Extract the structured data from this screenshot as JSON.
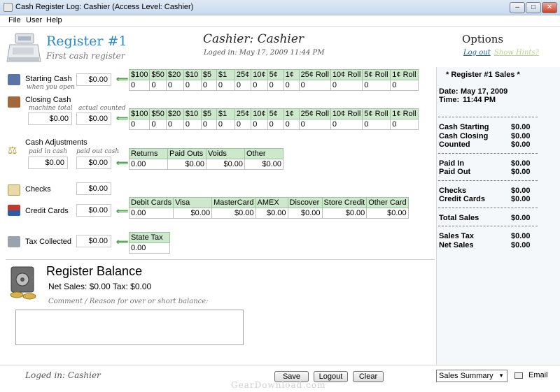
{
  "window": {
    "title": "Cash Register Log: Cashier (Access Level: Cashier)",
    "min": "–",
    "max": "□",
    "close": "✕"
  },
  "menu": [
    "File",
    "User",
    "Help"
  ],
  "header": {
    "register_title": "Register #1",
    "register_subtitle": "First cash register",
    "cashier_title": "Cashier: Cashier",
    "logged_time": "Loged in: May 17, 2009 11:44 PM",
    "options_title": "Options",
    "logout_link": "Log out",
    "hints_link": "Show Hints?"
  },
  "rows": {
    "starting": {
      "label": "Starting Cash",
      "sub": "when you open",
      "value": "$0.00"
    },
    "closing": {
      "label": "Closing Cash",
      "sub1": "machine total",
      "sub2": "actual counted",
      "value1": "$0.00",
      "value2": "$0.00"
    },
    "adjust": {
      "label": "Cash Adjustments",
      "sub1": "paid in cash",
      "sub2": "paid out cash",
      "value1": "$0.00",
      "value2": "$0.00"
    },
    "checks": {
      "label": "Checks",
      "value": "$0.00"
    },
    "credit": {
      "label": "Credit Cards",
      "value": "$0.00"
    },
    "tax": {
      "label": "Tax Collected",
      "value": "$0.00"
    }
  },
  "denominations": {
    "headers": [
      "$100",
      "$50",
      "$20",
      "$10",
      "$5",
      "$1",
      "25¢",
      "10¢",
      "5¢",
      "1¢",
      "25¢ Roll",
      "10¢ Roll",
      "5¢ Roll",
      "1¢ Roll"
    ],
    "starting_values": [
      "0",
      "0",
      "0",
      "0",
      "0",
      "0",
      "0",
      "0",
      "0",
      "0",
      "0",
      "0",
      "0",
      "0"
    ],
    "closing_values": [
      "0",
      "0",
      "0",
      "0",
      "0",
      "0",
      "0",
      "0",
      "0",
      "0",
      "0",
      "0",
      "0",
      "0"
    ]
  },
  "adjust_grid": {
    "headers": [
      "Returns",
      "Paid Outs",
      "Voids",
      "Other"
    ],
    "values": [
      "0.00",
      "$0.00",
      "$0.00",
      "$0.00"
    ]
  },
  "card_grid": {
    "headers": [
      "Debit Cards",
      "Visa",
      "MasterCard",
      "AMEX",
      "Discover",
      "Store Credit",
      "Other Card"
    ],
    "values": [
      "0.00",
      "$0.00",
      "$0.00",
      "$0.00",
      "$0.00",
      "$0.00",
      "$0.00"
    ]
  },
  "tax_grid": {
    "headers": [
      "State Tax"
    ],
    "values": [
      "0.00"
    ]
  },
  "summary": {
    "title": "* Register #1 Sales *",
    "date_label": "Date:",
    "date_value": "May 17, 2009",
    "time_label": "Time:",
    "time_value": "11:44 PM",
    "groups": [
      [
        {
          "label": "Cash Starting",
          "value": "$0.00"
        },
        {
          "label": "Cash Closing",
          "value": "$0.00"
        },
        {
          "label": "Counted",
          "value": "$0.00"
        }
      ],
      [
        {
          "label": "Paid In",
          "value": "$0.00"
        },
        {
          "label": "Paid Out",
          "value": "$0.00"
        }
      ],
      [
        {
          "label": "Checks",
          "value": "$0.00"
        },
        {
          "label": "Credit Cards",
          "value": "$0.00"
        }
      ],
      [
        {
          "label": "Total Sales",
          "value": "$0.00"
        }
      ],
      [
        {
          "label": "Sales Tax",
          "value": "$0.00"
        },
        {
          "label": "Net Sales",
          "value": "$0.00"
        }
      ]
    ]
  },
  "balance": {
    "title": "Register Balance",
    "line": "Net Sales: $0.00  Tax: $0.00",
    "comment_label": "Comment / Reason for over or short balance:"
  },
  "footer": {
    "logged": "Loged in: Cashier",
    "save": "Save",
    "logout": "Logout",
    "clear": "Clear",
    "select_value": "Sales Summary",
    "email": "Email",
    "watermark": "GearDownload.com"
  }
}
